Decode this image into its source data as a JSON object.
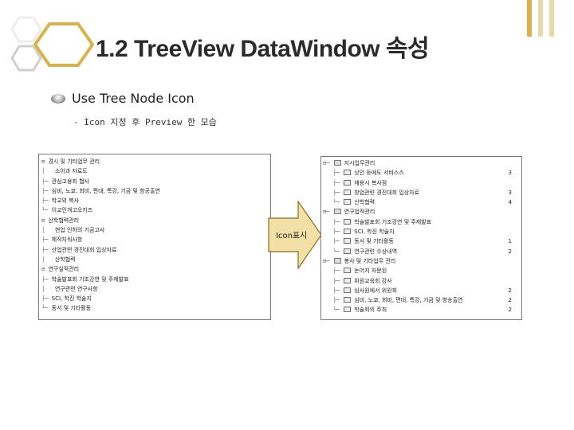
{
  "slide": {
    "title": "1.2 TreeView DataWindow 속성",
    "bullet": "Use Tree Node Icon",
    "subbullet": "- Icon 지정 후 Preview 한 모습",
    "arrow_label": "Icon표시",
    "colors": {
      "accent_gold": "#d9b24a",
      "hexagon_gray": "#c8c8c8",
      "arrow_fill": "#f3e0a6",
      "arrow_stroke": "#8a6d1a"
    }
  },
  "left_tree": {
    "rows": [
      {
        "guide": "⊟ ",
        "label": "경시 및 기타업무 관리"
      },
      {
        "guide": "│   ",
        "label": "소아과 자료도"
      },
      {
        "guide": "├─ ",
        "label": "관심고용회 협사"
      },
      {
        "guide": "├─ ",
        "label": "심비, 노쿄, 회비, 편대, 특강, 기금 및 항공출연"
      },
      {
        "guide": "├─ ",
        "label": "학교외 복사"
      },
      {
        "guide": "└─ ",
        "label": "이교인개고오키즈"
      },
      {
        "guide": "⊟ ",
        "label": "산학협력관리"
      },
      {
        "guide": "│   ",
        "label": "현업 인하의 기금고사"
      },
      {
        "guide": "├─ ",
        "label": "제작지워사항"
      },
      {
        "guide": "├─ ",
        "label": "산업관련 경진대회 입상자료"
      },
      {
        "guide": "│   ",
        "label": "산학협력"
      },
      {
        "guide": "⊟ ",
        "label": "연구실적관리"
      },
      {
        "guide": "├─ ",
        "label": "학술발표회 기조강연 및 주제발표"
      },
      {
        "guide": "│   ",
        "label": "연구관련 연구사항"
      },
      {
        "guide": "├─ ",
        "label": "SCI, 학진 학술지"
      },
      {
        "guide": "└─ ",
        "label": "동서 및 기타활동"
      }
    ]
  },
  "right_tree": {
    "rows": [
      {
        "guide": "⊟─ ",
        "icon": "folder",
        "label": "지시업무관리",
        "count": ""
      },
      {
        "guide": "   ├─ ",
        "icon": "doc",
        "label": "상인 등에도 서비스스",
        "count": "3"
      },
      {
        "guide": "   ├─ ",
        "icon": "doc",
        "label": "채용시 복사점",
        "count": ""
      },
      {
        "guide": "   ├─ ",
        "icon": "doc",
        "label": "창업관련 경진대회 입상자료",
        "count": "3"
      },
      {
        "guide": "   └─ ",
        "icon": "doc",
        "label": "산학협력",
        "count": "4"
      },
      {
        "guide": "⊟─ ",
        "icon": "folder",
        "label": "연구업적관리",
        "count": ""
      },
      {
        "guide": "   ├─ ",
        "icon": "doc",
        "label": "학술발표회 기조강연 및 주제발표",
        "count": ""
      },
      {
        "guide": "   ├─ ",
        "icon": "doc",
        "label": "SCI, 학진 학술지",
        "count": ""
      },
      {
        "guide": "   ├─ ",
        "icon": "doc",
        "label": "동서 및 기타활동",
        "count": "1"
      },
      {
        "guide": "   └─ ",
        "icon": "doc",
        "label": "연구관련 수상내역",
        "count": "2"
      },
      {
        "guide": "⊟─ ",
        "icon": "folder",
        "label": "봉사 및 기타업무 관리",
        "count": ""
      },
      {
        "guide": "   ├─ ",
        "icon": "doc",
        "label": "논어지 자문된",
        "count": ""
      },
      {
        "guide": "   ├─ ",
        "icon": "doc",
        "label": "위원교육회 강사",
        "count": ""
      },
      {
        "guide": "   ├─ ",
        "icon": "doc",
        "label": "심사원에서 위원회",
        "count": "2"
      },
      {
        "guide": "   ├─ ",
        "icon": "doc",
        "label": "심비, 노쿄, 회비, 편대, 특강, 기금 및 항송출연",
        "count": "2"
      },
      {
        "guide": "   └─ ",
        "icon": "doc",
        "label": "학술회의 주최",
        "count": "2"
      }
    ]
  }
}
